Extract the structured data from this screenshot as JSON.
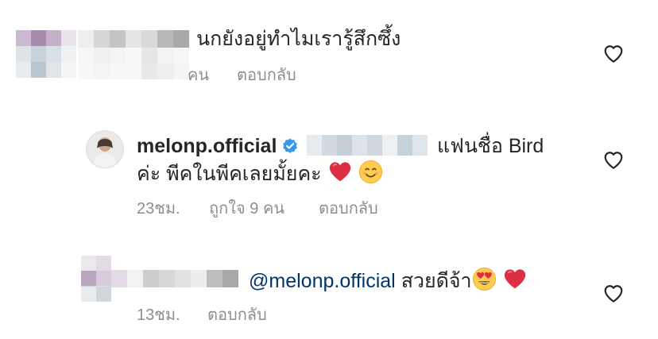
{
  "comments": [
    {
      "text": "นกยังอยู่ทำไมเรารู้สึกซึ้ง",
      "likes_partial": "คน",
      "reply_label": "ตอบกลับ"
    },
    {
      "username": "melonp.official",
      "line1_suffix": "แฟนชื่อ Bird",
      "line2": "ค่ะ พีคในพีคเลยมั้ยคะ",
      "time": "23ชม.",
      "likes": "ถูกใจ 9 คน",
      "reply_label": "ตอบกลับ"
    },
    {
      "mention": "@melonp.official",
      "text": "สวยดีจ้า",
      "time": "13ชม.",
      "reply_label": "ตอบกลับ"
    }
  ],
  "icons": {
    "heart": "heart-outline-icon",
    "verified": "verified-badge-icon",
    "emoji_heart": "red-heart-emoji",
    "emoji_smile": "smiling-face-emoji",
    "emoji_hearteyes": "heart-eyes-emoji"
  },
  "colors": {
    "text": "#262626",
    "meta": "#8e8e8e",
    "mention": "#00376b",
    "verified": "#3897f0",
    "heart_icon": "#262626"
  }
}
